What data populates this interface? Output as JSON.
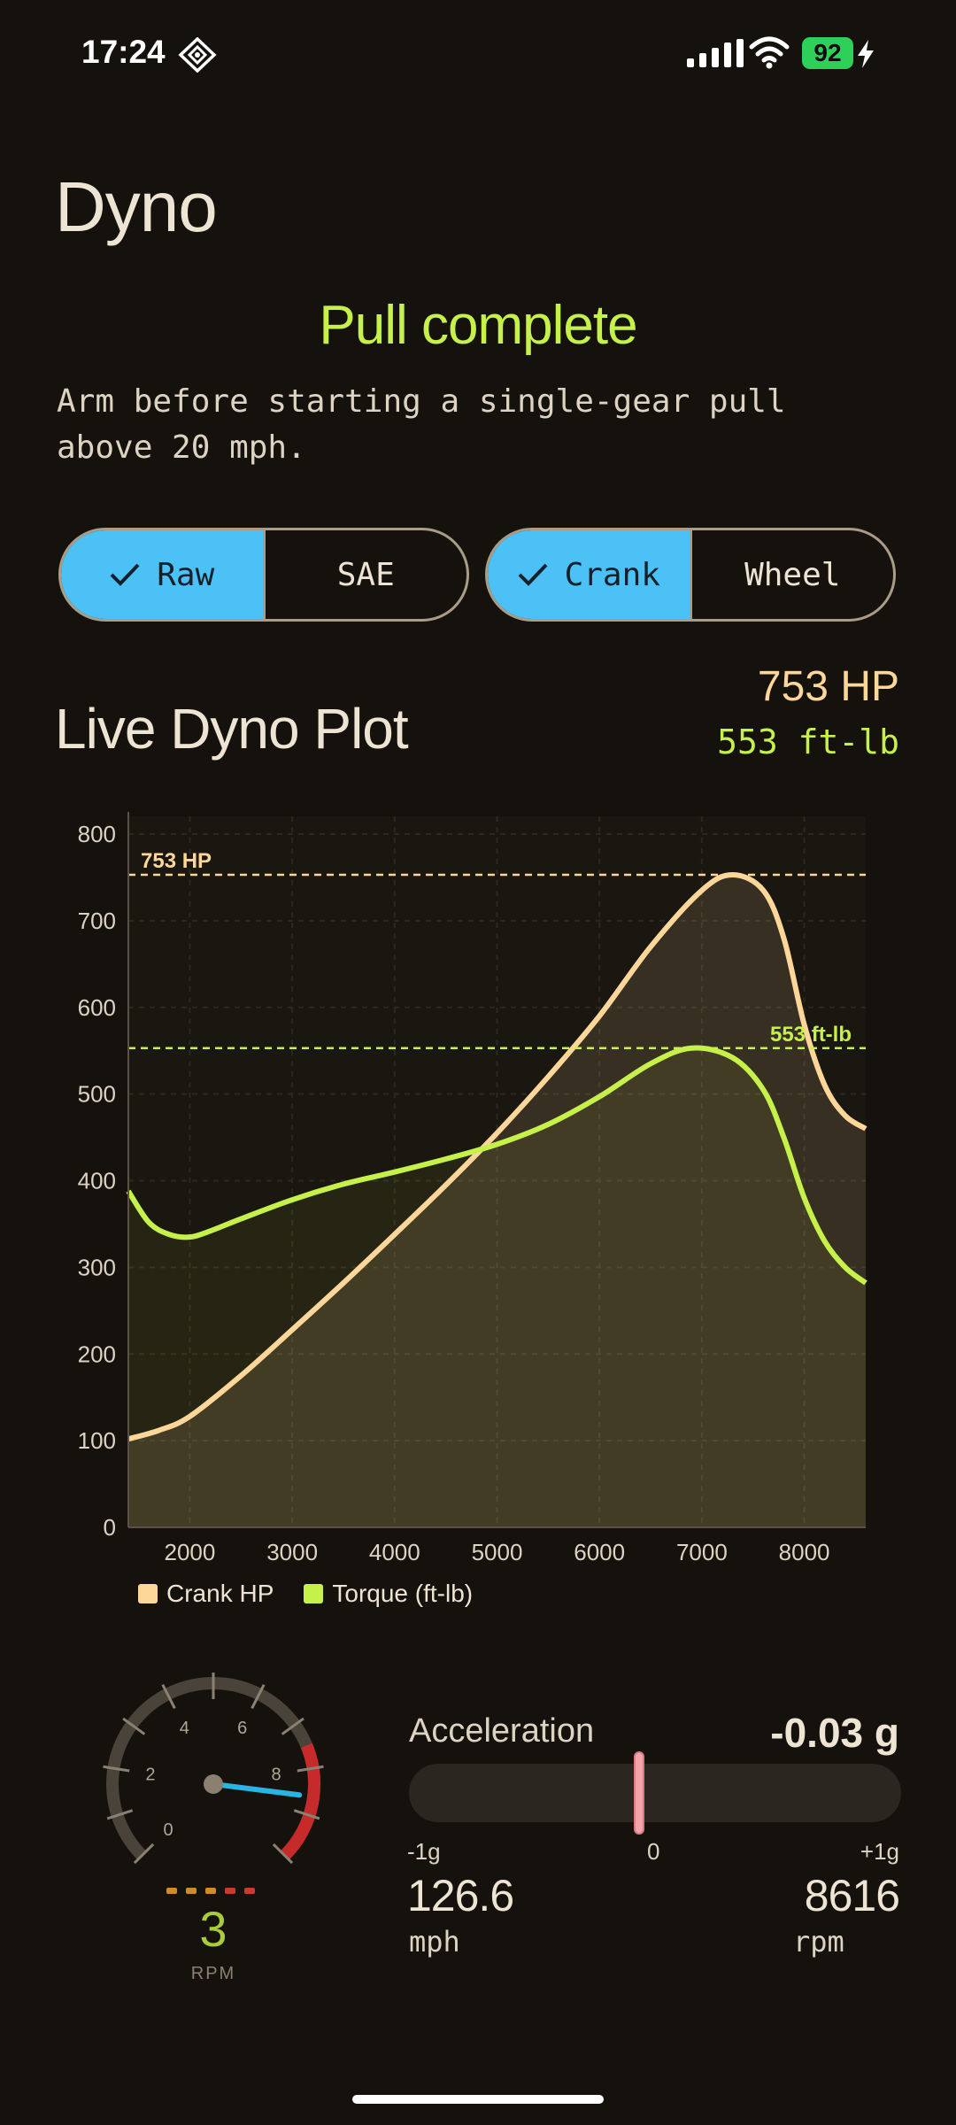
{
  "status_bar": {
    "time": "17:24",
    "battery": "92"
  },
  "page": {
    "title": "Dyno",
    "pull_status": "Pull complete",
    "instruction": "Arm before starting a single-gear pull above 20 mph."
  },
  "toggles": {
    "correction": {
      "options": [
        "Raw",
        "SAE"
      ],
      "selected": "Raw"
    },
    "measurement": {
      "options": [
        "Crank",
        "Wheel"
      ],
      "selected": "Crank"
    }
  },
  "plot": {
    "title": "Live Dyno Plot",
    "peak_hp": "753 HP",
    "peak_torque": "553 ft-lb"
  },
  "chart_data": {
    "type": "line",
    "xlim": [
      1400,
      8600
    ],
    "ylim": [
      0,
      800
    ],
    "x_ticks": [
      2000,
      3000,
      4000,
      5000,
      6000,
      7000,
      8000
    ],
    "y_ticks": [
      0,
      100,
      200,
      300,
      400,
      500,
      600,
      700,
      800
    ],
    "series": [
      {
        "name": "Crank HP",
        "color": "#fdd79a",
        "points": [
          [
            1400,
            102
          ],
          [
            1700,
            112
          ],
          [
            2000,
            128
          ],
          [
            2500,
            175
          ],
          [
            3000,
            228
          ],
          [
            3500,
            282
          ],
          [
            4000,
            338
          ],
          [
            4500,
            395
          ],
          [
            5000,
            455
          ],
          [
            5500,
            520
          ],
          [
            6000,
            590
          ],
          [
            6500,
            670
          ],
          [
            7000,
            735
          ],
          [
            7300,
            753
          ],
          [
            7600,
            735
          ],
          [
            7800,
            680
          ],
          [
            8000,
            580
          ],
          [
            8200,
            510
          ],
          [
            8400,
            475
          ],
          [
            8600,
            460
          ]
        ]
      },
      {
        "name": "Torque (ft-lb)",
        "color": "#c6f04a",
        "points": [
          [
            1400,
            388
          ],
          [
            1600,
            352
          ],
          [
            1800,
            338
          ],
          [
            2000,
            335
          ],
          [
            2200,
            342
          ],
          [
            2500,
            356
          ],
          [
            3000,
            378
          ],
          [
            3500,
            396
          ],
          [
            4000,
            410
          ],
          [
            4500,
            425
          ],
          [
            5000,
            442
          ],
          [
            5500,
            465
          ],
          [
            6000,
            497
          ],
          [
            6500,
            535
          ],
          [
            6900,
            553
          ],
          [
            7300,
            542
          ],
          [
            7600,
            505
          ],
          [
            7800,
            450
          ],
          [
            8000,
            380
          ],
          [
            8200,
            330
          ],
          [
            8400,
            300
          ],
          [
            8600,
            282
          ]
        ]
      }
    ],
    "reference_lines": [
      {
        "label": "753 HP",
        "value": 753,
        "color": "#fdd79a"
      },
      {
        "label": "553 ft-lb",
        "value": 553,
        "color": "#c6f04a"
      }
    ]
  },
  "gauge": {
    "tick_labels": [
      "0",
      "2",
      "4",
      "6",
      "8"
    ],
    "needle_value": 8.6,
    "gear": "3",
    "caption": "RPM"
  },
  "acceleration": {
    "label": "Acceleration",
    "value": "-0.03 g",
    "value_g": -0.03,
    "min_label": "-1g",
    "mid_label": "0",
    "max_label": "+1g"
  },
  "readouts": {
    "speed": "126.6",
    "speed_unit": "mph",
    "rpm": "8616",
    "rpm_unit": "rpm"
  }
}
